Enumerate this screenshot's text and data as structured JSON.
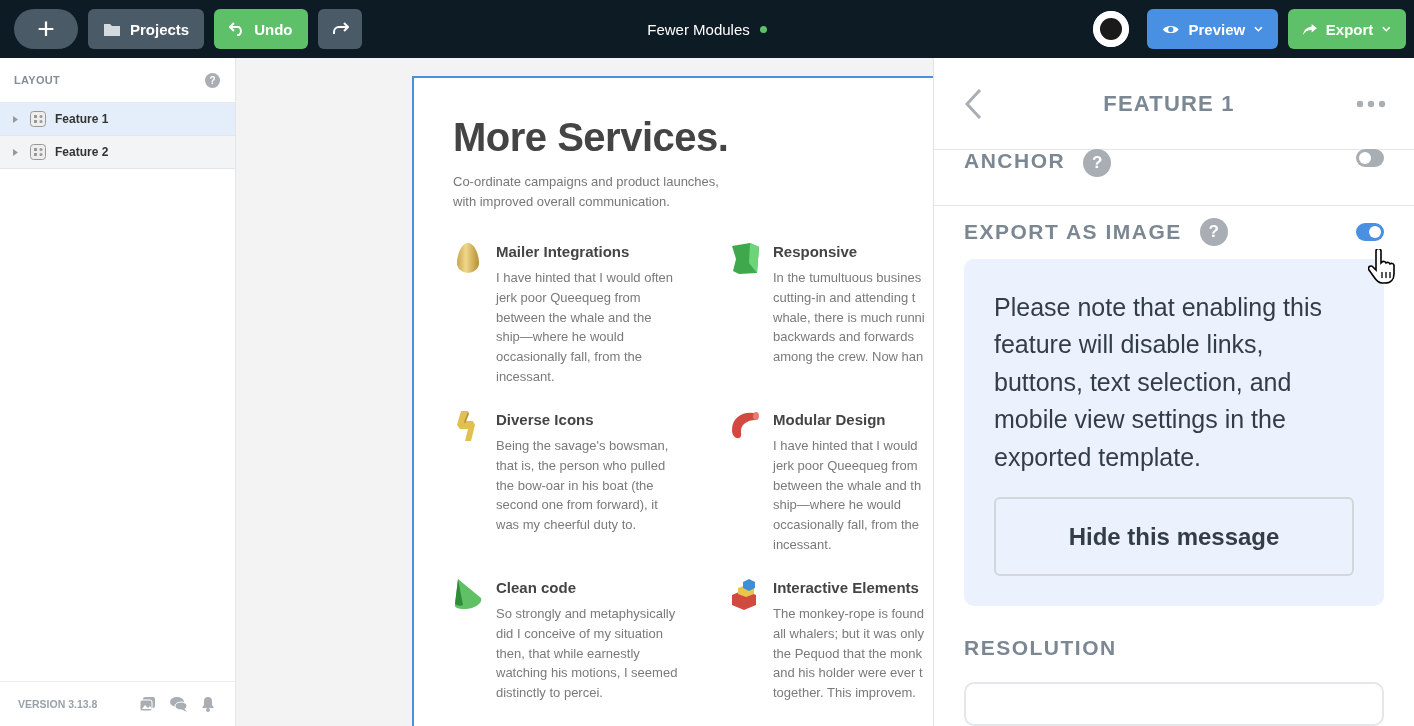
{
  "topbar": {
    "add_button": "+",
    "projects_button": "Projects",
    "undo_button": "Undo",
    "title": "Fewer Modules",
    "saved": true,
    "preview_button": "Preview",
    "export_button": "Export"
  },
  "sidebar": {
    "title": "LAYOUT",
    "help": "?",
    "items": [
      {
        "label": "Feature 1",
        "selected": true
      },
      {
        "label": "Feature 2",
        "selected": false
      }
    ],
    "version": "VERSION 3.13.8"
  },
  "canvas": {
    "title": "More Services.",
    "subtitle": [
      "Co-ordinate campaigns and product launches,",
      "with improved overall communication."
    ],
    "features": [
      {
        "title": "Mailer Integrations",
        "lines": [
          "I have hinted that I would often",
          "jerk poor Queequeg from",
          "between the whale and the",
          "ship—where he would",
          "occasionally fall, from the",
          "incessant."
        ]
      },
      {
        "title": "Responsive",
        "lines": [
          "In the tumultuous busines",
          "cutting-in and attending t",
          "whale, there is much runni",
          "backwards and forwards",
          "among the crew. Now han"
        ]
      },
      {
        "title": "Diverse Icons",
        "lines": [
          "Being the savage's bowsman,",
          "that is, the person who pulled",
          "the bow-oar in his boat (the",
          "second one from forward), it",
          "was my cheerful duty to."
        ]
      },
      {
        "title": "Modular Design",
        "lines": [
          "I have hinted that I would",
          "jerk poor Queequeg from",
          "between the whale and th",
          "ship—where he would",
          "occasionally fall, from the",
          "incessant."
        ]
      },
      {
        "title": "Clean code",
        "lines": [
          "So strongly and metaphysically",
          "did I conceive of my situation",
          "then, that while earnestly",
          "watching his motions, I seemed",
          "distinctly to percei."
        ]
      },
      {
        "title": "Interactive Elements",
        "lines": [
          "The monkey-rope is found",
          "all whalers; but it was only",
          "the Pequod that the monk",
          "and his holder were ever t",
          "together. This improvem."
        ]
      }
    ]
  },
  "panel": {
    "title": "FEATURE 1",
    "settings": [
      {
        "label": "ANCHOR",
        "help": "?",
        "on": false
      },
      {
        "label": "EXPORT AS IMAGE",
        "help": "?",
        "on": true
      }
    ],
    "notice": "Please note that enabling this feature will disable links, buttons, text selection, and mobile view settings in the exported template.",
    "notice_button": "Hide this message",
    "resolution_label": "RESOLUTION"
  }
}
